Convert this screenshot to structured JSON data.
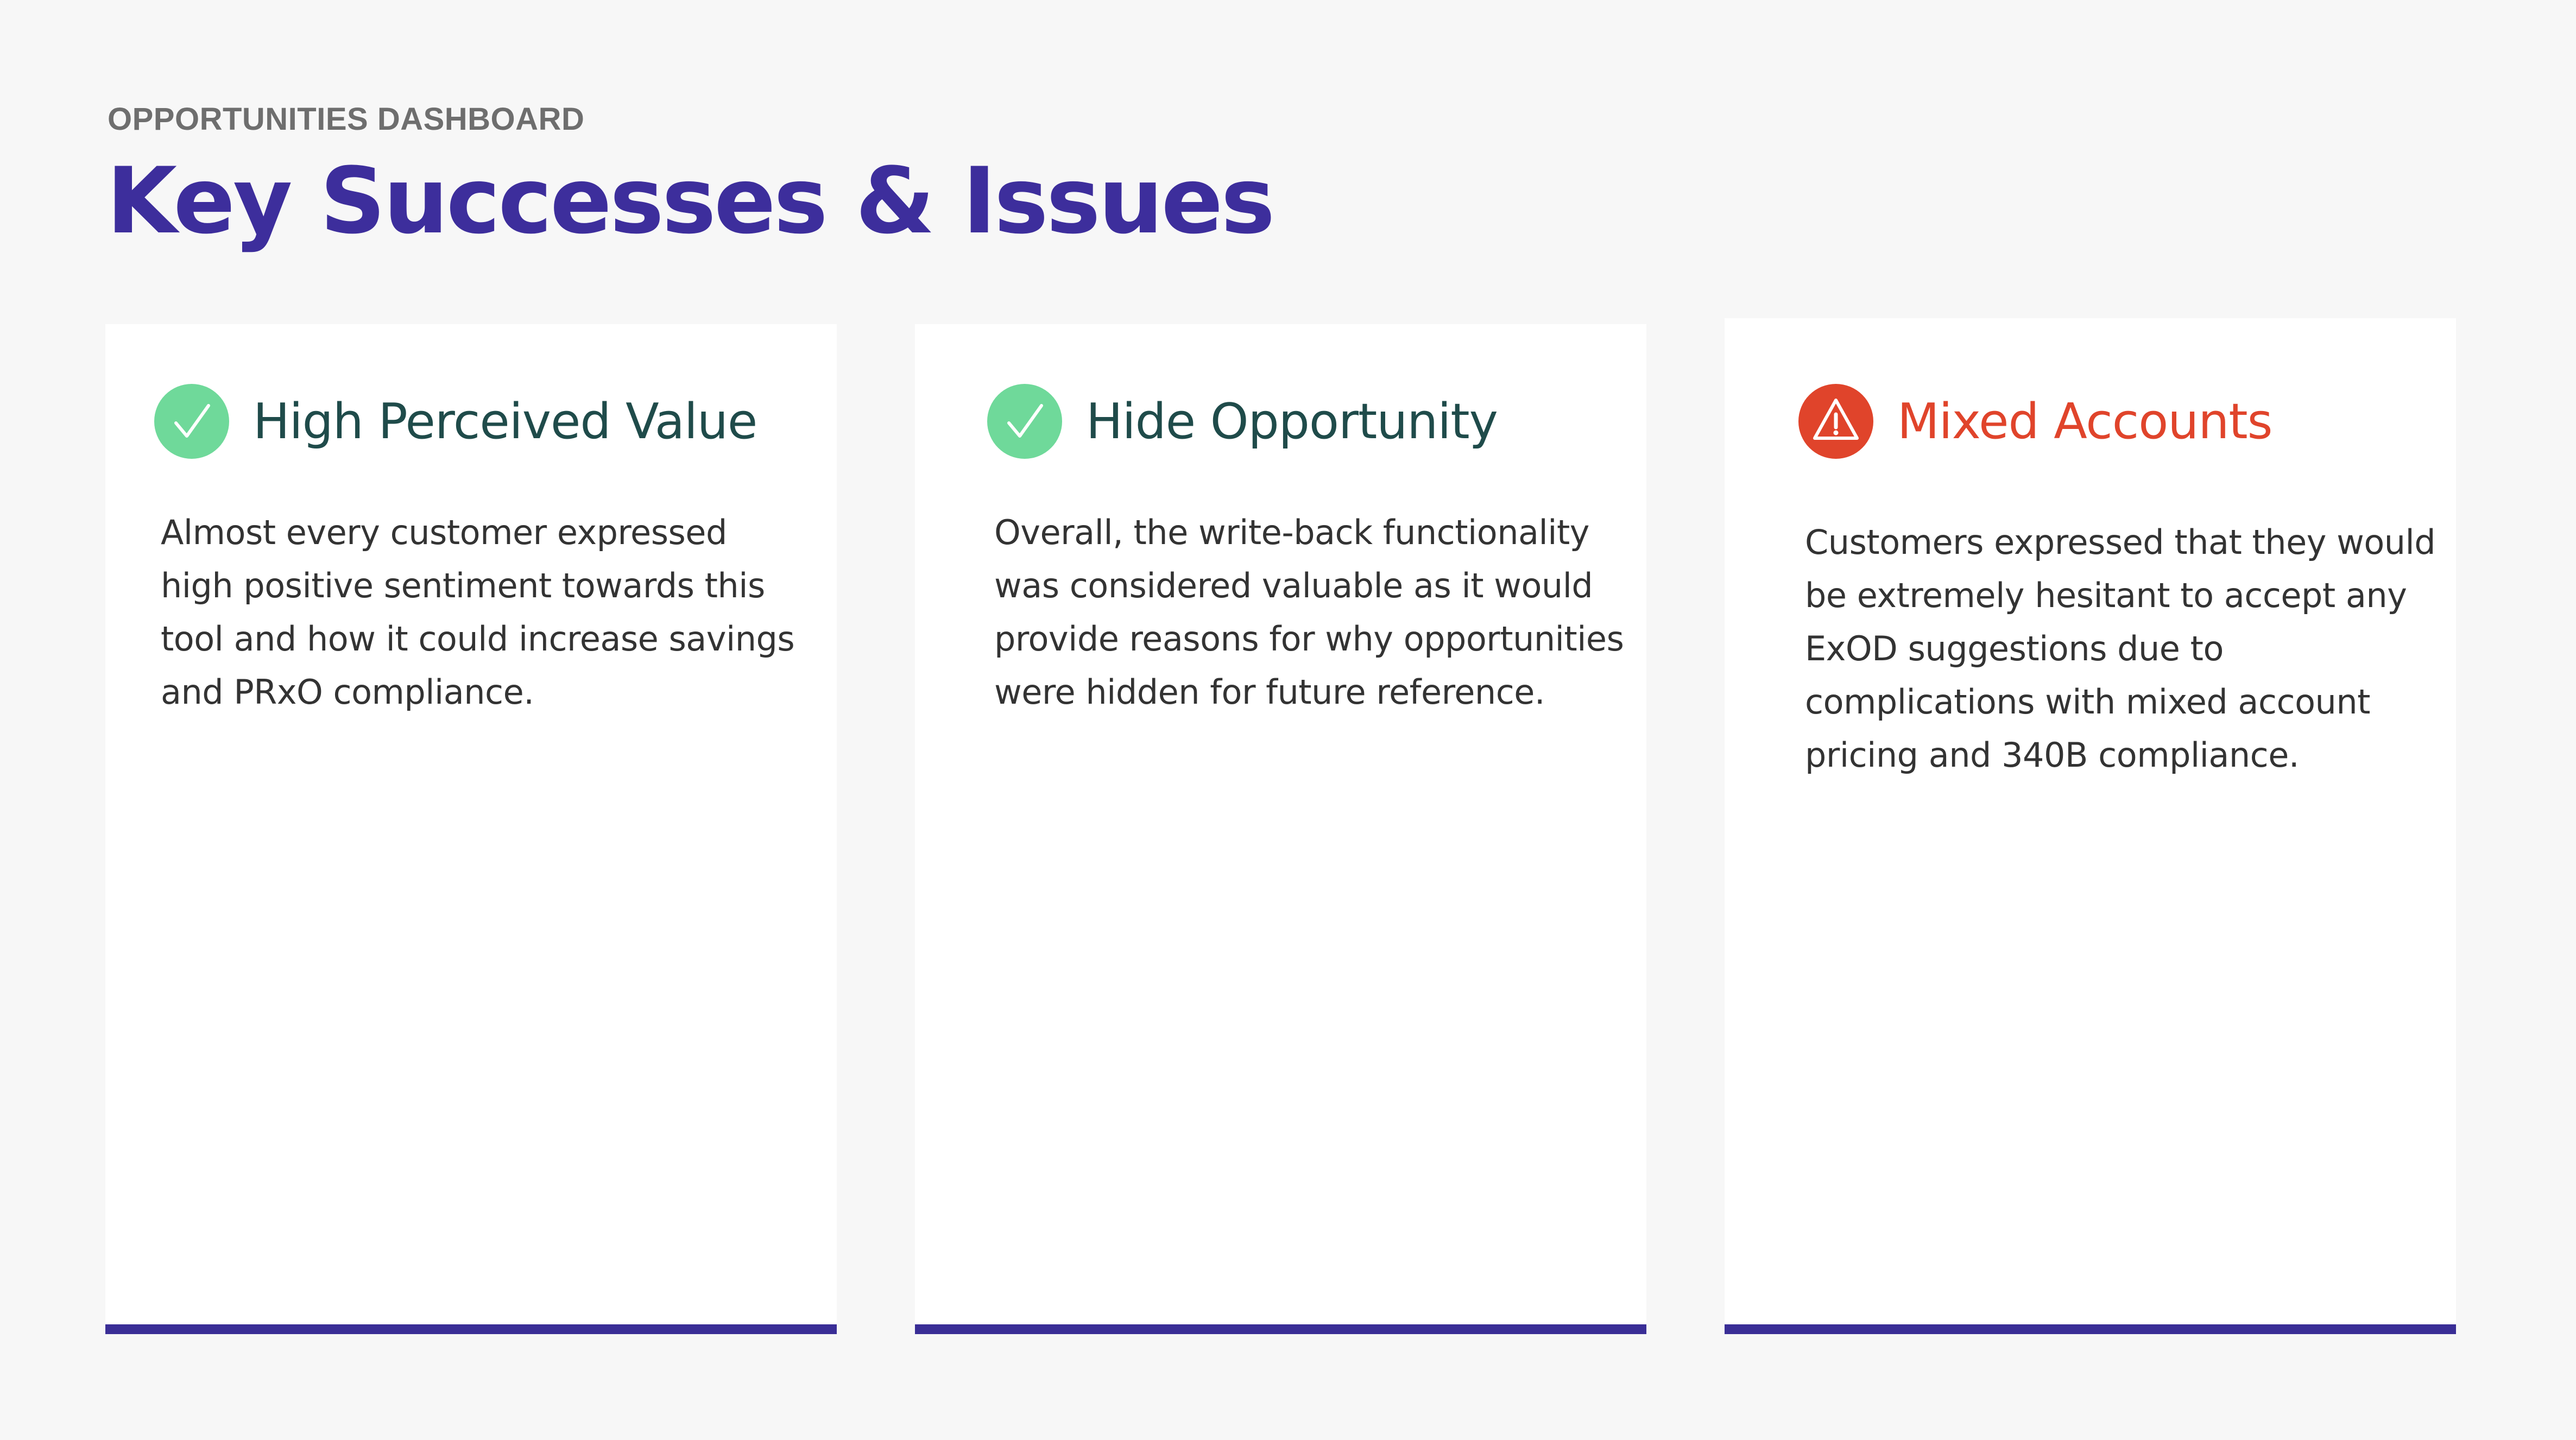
{
  "header": {
    "eyebrow": "OPPORTUNITIES DASHBOARD",
    "title": "Key Successes & Issues"
  },
  "colors": {
    "brand_purple": "#3d2e9c",
    "success_green": "#6fd99a",
    "success_text": "#1f4b4a",
    "issue_red": "#e0442b",
    "bar_purple": "#3a2e96"
  },
  "cards": [
    {
      "status": "success",
      "icon": "checkmark-circle-icon",
      "title": "High Perceived Value",
      "body": "Almost every customer expressed high positive sentiment towards this tool and how it could increase savings and PRxO compliance."
    },
    {
      "status": "success",
      "icon": "checkmark-circle-icon",
      "title": "Hide Opportunity",
      "body": "Overall, the write-back functionality was considered valuable as it would provide reasons for why opportunities were hidden for future reference."
    },
    {
      "status": "issue",
      "icon": "warning-triangle-icon",
      "title": "Mixed Accounts",
      "body": "Customers expressed that they would be extremely hesitant to accept any ExOD suggestions due to complications with mixed account pricing and 340B compliance."
    }
  ]
}
